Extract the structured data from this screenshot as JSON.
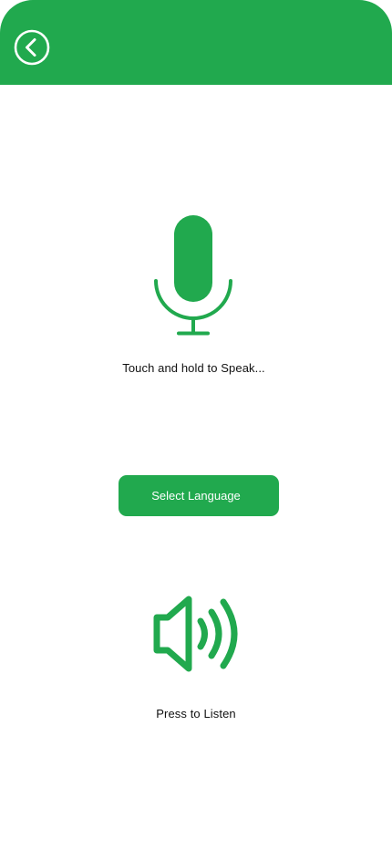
{
  "colors": {
    "accent": "#21a94e",
    "background": "#ffffff",
    "text": "#111111"
  },
  "header": {
    "back_icon": "chevron-left-circle-icon"
  },
  "voice": {
    "mic_icon": "microphone-icon",
    "hint": "Touch and hold to Speak..."
  },
  "language": {
    "button_label": "Select Language"
  },
  "playback": {
    "speaker_icon": "speaker-volume-icon",
    "label": "Press to Listen"
  }
}
